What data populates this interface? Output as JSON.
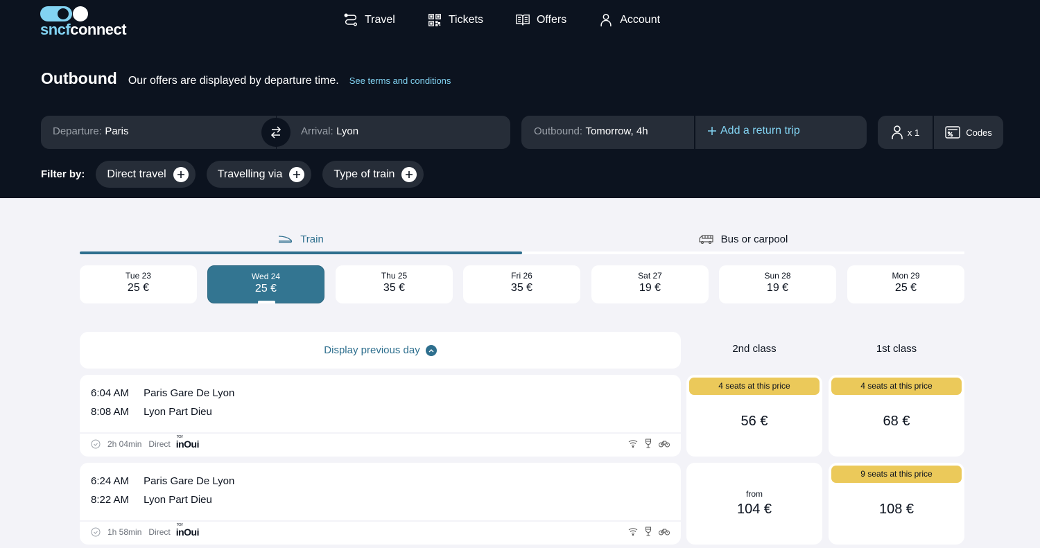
{
  "brand": {
    "logo_part1": "sncf",
    "logo_part2": "connect"
  },
  "nav": {
    "items": [
      {
        "label": "Travel",
        "icon": "route-icon"
      },
      {
        "label": "Tickets",
        "icon": "qr-code-icon"
      },
      {
        "label": "Offers",
        "icon": "book-icon"
      },
      {
        "label": "Account",
        "icon": "user-icon"
      }
    ]
  },
  "page": {
    "title": "Outbound",
    "subtitle": "Our offers are displayed by departure time.",
    "terms_link": "See terms and conditions"
  },
  "search": {
    "departure_label": "Departure:",
    "departure_value": "Paris",
    "arrival_label": "Arrival:",
    "arrival_value": "Lyon",
    "outbound_label": "Outbound:",
    "outbound_value": "Tomorrow, 4h",
    "return_label": "Add a return trip",
    "passengers": "x 1",
    "codes_label": "Codes"
  },
  "filters": {
    "label": "Filter by:",
    "chips": [
      "Direct travel",
      "Travelling via",
      "Type of train"
    ]
  },
  "mode_tabs": {
    "train": "Train",
    "bus": "Bus or carpool",
    "active": "train"
  },
  "dates": [
    {
      "day": "Tue 23",
      "price": "25 €"
    },
    {
      "day": "Wed 24",
      "price": "25 €",
      "active": true
    },
    {
      "day": "Thu 25",
      "price": "35 €"
    },
    {
      "day": "Fri 26",
      "price": "35 €"
    },
    {
      "day": "Sat 27",
      "price": "19 €"
    },
    {
      "day": "Sun 28",
      "price": "19 €"
    },
    {
      "day": "Mon 29",
      "price": "25 €"
    }
  ],
  "results": {
    "prev_day_label": "Display previous day",
    "class_headers": [
      "2nd class",
      "1st class"
    ],
    "journeys": [
      {
        "dep_time": "6:04 AM",
        "dep_station": "Paris Gare De Lyon",
        "arr_time": "8:08 AM",
        "arr_station": "Lyon Part Dieu",
        "duration": "2h 04min",
        "type": "Direct",
        "operator": "inOui",
        "operator_small": "TGV",
        "second": {
          "badge": "4 seats at this price",
          "from": "",
          "price": "56 €"
        },
        "first": {
          "badge": "4 seats at this price",
          "from": "",
          "price": "68 €"
        }
      },
      {
        "dep_time": "6:24 AM",
        "dep_station": "Paris Gare De Lyon",
        "arr_time": "8:22 AM",
        "arr_station": "Lyon Part Dieu",
        "duration": "1h 58min",
        "type": "Direct",
        "operator": "inOui",
        "operator_small": "TGV",
        "second": {
          "badge": "",
          "from": "from",
          "price": "104 €"
        },
        "first": {
          "badge": "9 seats at this price",
          "from": "",
          "price": "108 €"
        }
      }
    ]
  },
  "colors": {
    "header_bg": "#0c131f",
    "field_bg": "#262d38",
    "accent": "#2e6f8e",
    "link": "#82d3f2",
    "badge": "#ebc95a",
    "page_bg": "#f3f3f8"
  }
}
